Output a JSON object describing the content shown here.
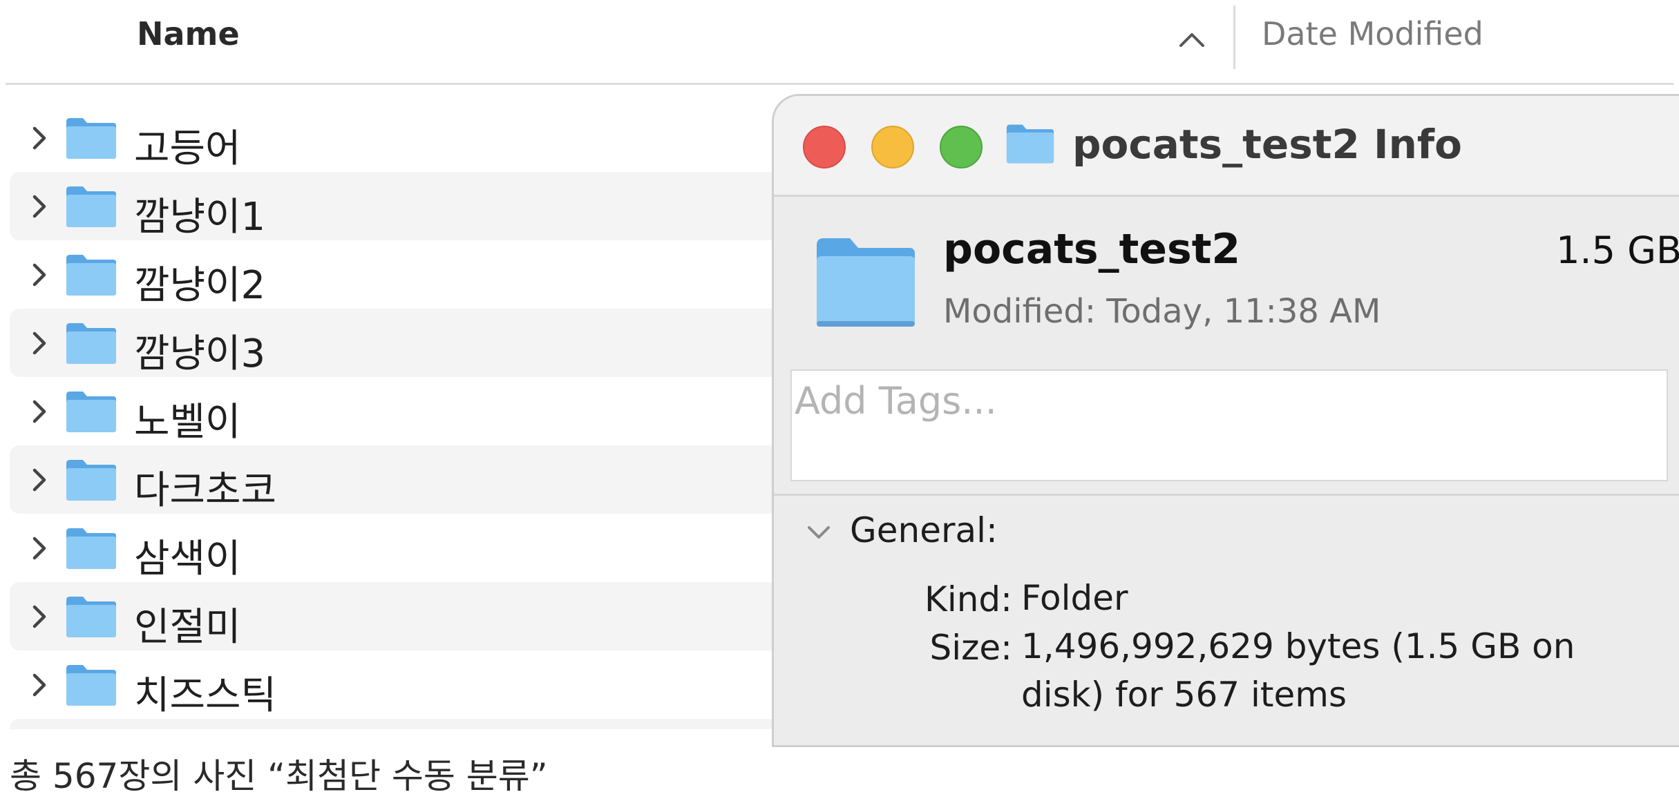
{
  "finder": {
    "columns": {
      "name": "Name",
      "date_modified": "Date Modified"
    },
    "sort_icon": "chevron-up-icon",
    "folders": [
      {
        "label": "고등어"
      },
      {
        "label": "깜냥이1"
      },
      {
        "label": "깜냥이2"
      },
      {
        "label": "깜냥이3"
      },
      {
        "label": "노벨이"
      },
      {
        "label": "다크초코"
      },
      {
        "label": "삼색이"
      },
      {
        "label": "인절미"
      },
      {
        "label": "치즈스틱"
      }
    ],
    "folder_color": "#79bdf0"
  },
  "info_window": {
    "title": "pocats_test2 Info",
    "item_name": "pocats_test2",
    "item_size": "1.5 GB",
    "modified": "Modified:  Today, 11:38 AM",
    "tags_placeholder": "Add Tags...",
    "general": {
      "label": "General:",
      "kind_key": "Kind:",
      "kind_value": "Folder",
      "size_key": "Size:",
      "size_value": "1,496,992,629 bytes (1.5 GB on disk) for 567 items"
    },
    "traffic_lights": {
      "close": "#ee5c57",
      "minimize": "#f6bd3f",
      "zoom": "#5fc04f"
    }
  },
  "caption": "총 567장의 사진 “최첨단 수동 분류”"
}
